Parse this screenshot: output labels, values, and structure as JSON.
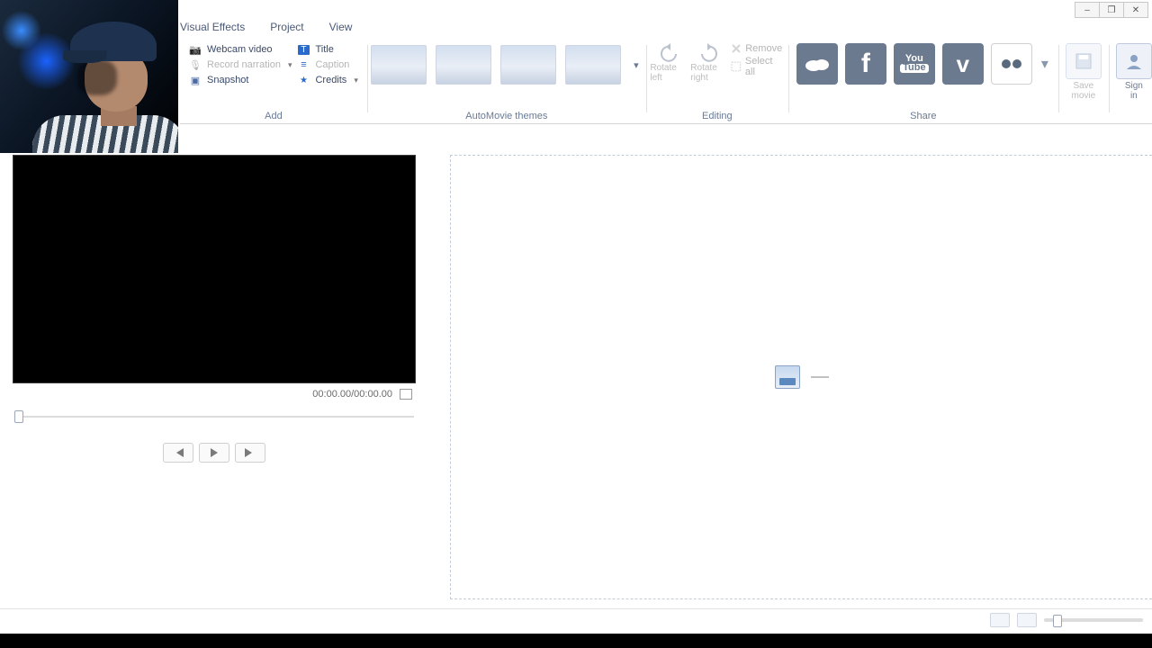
{
  "window": {
    "minimize": "–",
    "maximize": "❐",
    "close": "✕"
  },
  "tabs": {
    "visual_effects": "Visual Effects",
    "project": "Project",
    "view": "View"
  },
  "ribbon": {
    "add": {
      "group_title": "Add",
      "webcam_video": "Webcam video",
      "record_narration": "Record narration",
      "snapshot": "Snapshot",
      "title": "Title",
      "caption": "Caption",
      "credits": "Credits"
    },
    "themes": {
      "group_title": "AutoMovie themes"
    },
    "editing": {
      "group_title": "Editing",
      "rotate_left": "Rotate left",
      "rotate_right": "Rotate right",
      "remove": "Remove",
      "select_all": "Select all"
    },
    "share": {
      "group_title": "Share",
      "onedrive": "OneDrive",
      "facebook": "Facebook",
      "youtube": "YouTube",
      "vimeo": "Vimeo",
      "flickr": "Flickr"
    },
    "save": {
      "label_line1": "Save",
      "label_line2": "movie"
    },
    "signin": {
      "label_line1": "Sign",
      "label_line2": "in"
    }
  },
  "preview": {
    "time_current": "00:00.00",
    "time_total": "00:00.00",
    "time_sep": "/"
  }
}
